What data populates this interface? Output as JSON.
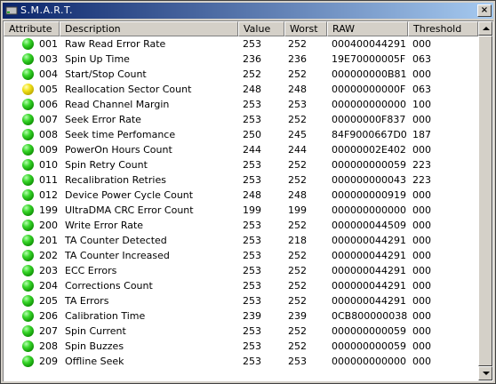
{
  "window": {
    "title": "S.M.A.R.T.",
    "close_label": "×"
  },
  "columns": [
    {
      "key": "attribute",
      "label": "Attribute"
    },
    {
      "key": "description",
      "label": "Description"
    },
    {
      "key": "value",
      "label": "Value"
    },
    {
      "key": "worst",
      "label": "Worst"
    },
    {
      "key": "raw",
      "label": "RAW"
    },
    {
      "key": "threshold",
      "label": "Threshold"
    }
  ],
  "status_colors": {
    "green": "#22c010",
    "yellow": "#e6d400"
  },
  "rows": [
    {
      "status": "green",
      "id": "001",
      "description": "Raw Read Error Rate",
      "value": "253",
      "worst": "252",
      "raw": "000400044291",
      "threshold": "000"
    },
    {
      "status": "green",
      "id": "003",
      "description": "Spin Up Time",
      "value": "236",
      "worst": "236",
      "raw": "19E70000005F",
      "threshold": "063"
    },
    {
      "status": "green",
      "id": "004",
      "description": "Start/Stop Count",
      "value": "252",
      "worst": "252",
      "raw": "000000000B81",
      "threshold": "000"
    },
    {
      "status": "yellow",
      "id": "005",
      "description": "Reallocation Sector Count",
      "value": "248",
      "worst": "248",
      "raw": "00000000000F",
      "threshold": "063"
    },
    {
      "status": "green",
      "id": "006",
      "description": "Read Channel Margin",
      "value": "253",
      "worst": "253",
      "raw": "000000000000",
      "threshold": "100"
    },
    {
      "status": "green",
      "id": "007",
      "description": "Seek Error Rate",
      "value": "253",
      "worst": "252",
      "raw": "00000000F837",
      "threshold": "000"
    },
    {
      "status": "green",
      "id": "008",
      "description": "Seek time Perfomance",
      "value": "250",
      "worst": "245",
      "raw": "84F9000667D0",
      "threshold": "187"
    },
    {
      "status": "green",
      "id": "009",
      "description": "PowerOn Hours Count",
      "value": "244",
      "worst": "244",
      "raw": "00000002E402",
      "threshold": "000"
    },
    {
      "status": "green",
      "id": "010",
      "description": "Spin Retry Count",
      "value": "253",
      "worst": "252",
      "raw": "000000000059",
      "threshold": "223"
    },
    {
      "status": "green",
      "id": "011",
      "description": "Recalibration Retries",
      "value": "253",
      "worst": "252",
      "raw": "000000000043",
      "threshold": "223"
    },
    {
      "status": "green",
      "id": "012",
      "description": "Device Power Cycle Count",
      "value": "248",
      "worst": "248",
      "raw": "000000000919",
      "threshold": "000"
    },
    {
      "status": "green",
      "id": "199",
      "description": "UltraDMA CRC Error Count",
      "value": "199",
      "worst": "199",
      "raw": "000000000000",
      "threshold": "000"
    },
    {
      "status": "green",
      "id": "200",
      "description": "Write Error Rate",
      "value": "253",
      "worst": "252",
      "raw": "000000044509",
      "threshold": "000"
    },
    {
      "status": "green",
      "id": "201",
      "description": "TA Counter Detected",
      "value": "253",
      "worst": "218",
      "raw": "000000044291",
      "threshold": "000"
    },
    {
      "status": "green",
      "id": "202",
      "description": "TA Counter Increased",
      "value": "253",
      "worst": "252",
      "raw": "000000044291",
      "threshold": "000"
    },
    {
      "status": "green",
      "id": "203",
      "description": "ECC Errors",
      "value": "253",
      "worst": "252",
      "raw": "000000044291",
      "threshold": "000"
    },
    {
      "status": "green",
      "id": "204",
      "description": "Corrections Count",
      "value": "253",
      "worst": "252",
      "raw": "000000044291",
      "threshold": "000"
    },
    {
      "status": "green",
      "id": "205",
      "description": "TA Errors",
      "value": "253",
      "worst": "252",
      "raw": "000000044291",
      "threshold": "000"
    },
    {
      "status": "green",
      "id": "206",
      "description": "Calibration Time",
      "value": "239",
      "worst": "239",
      "raw": "0CB800000038",
      "threshold": "000"
    },
    {
      "status": "green",
      "id": "207",
      "description": "Spin Current",
      "value": "253",
      "worst": "252",
      "raw": "000000000059",
      "threshold": "000"
    },
    {
      "status": "green",
      "id": "208",
      "description": "Spin Buzzes",
      "value": "253",
      "worst": "252",
      "raw": "000000000059",
      "threshold": "000"
    },
    {
      "status": "green",
      "id": "209",
      "description": "Offline Seek",
      "value": "253",
      "worst": "253",
      "raw": "000000000000",
      "threshold": "000"
    }
  ]
}
